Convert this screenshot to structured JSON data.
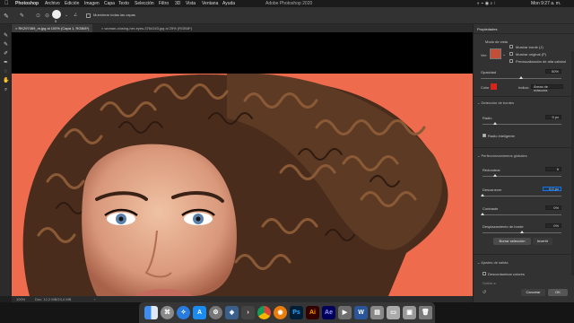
{
  "menubar": {
    "apple": "",
    "items": [
      "Photoshop",
      "Archivo",
      "Edición",
      "Imagen",
      "Capa",
      "Texto",
      "Selección",
      "Filtro",
      "3D",
      "Vista",
      "Ventana",
      "Ayuda"
    ],
    "window_title": "Adobe Photoshop 2020",
    "clock": "Mon 9:27 a. m."
  },
  "optbar": {
    "size_value": "5",
    "sample_all_layers": "Muestrear todas las capas"
  },
  "tabs": [
    {
      "label": "RK297469_m.jpg al 100% (Capa 1, RGB/8*)"
    },
    {
      "label": "woman-closing-her-eyes-3764163.jpg al 25% (RGB/8*)"
    }
  ],
  "status": {
    "zoom": "100%",
    "doc": "Doc: 12,2 MB/24,4 MB"
  },
  "panel": {
    "title": "Propiedades",
    "view_mode_label": "Modo de vista",
    "view_label": "Ver:",
    "show_edge": "Mostrar borde (J)",
    "show_original": "Mostrar original (P)",
    "hq_preview": "Previsualización de alta calidad",
    "opacity_label": "Opacidad",
    "opacity_value": "50%",
    "color_label": "Color",
    "indicate_label": "Indica:",
    "indicate_value": "Áreas de máscara",
    "edge_detection": "Detección de bordes",
    "radius_label": "Radio",
    "radius_value": "5 px",
    "smart_radius": "Radio inteligente",
    "global_refinements": "Perfeccionamientos globales",
    "smooth_label": "Redondear",
    "smooth_value": "6",
    "feather_label": "Desvanecer",
    "feather_value": "0,0 px",
    "contrast_label": "Contraste",
    "contrast_value": "0%",
    "shift_edge_label": "Desplazamiento de borde",
    "shift_edge_value": "0%",
    "clear_selection": "Borrar selección",
    "invert": "Invertir",
    "output_settings": "Ajustes de salida",
    "decontaminate": "Descontaminar colores",
    "output_to_label": "Salida a:",
    "cancel": "Cancelar",
    "ok": "OK"
  },
  "colors": {
    "photo_bg": "#ef6b4d",
    "edge_color": "#d8241b",
    "accent": "#1473e6"
  },
  "dock": {
    "icons": [
      "finder-icon",
      "launchpad-icon",
      "safari-icon",
      "app-store-icon",
      "settings-icon",
      "photos-icon",
      "chrome-icon",
      "blender-icon",
      "photoshop-icon",
      "illustrator-icon",
      "after-effects-icon",
      "word-icon",
      "terminal-icon",
      "preview-icon",
      "trash-icon"
    ],
    "ps_label": "Ps",
    "ai_label": "Ai",
    "ae_label": "Ae",
    "w_label": "W"
  }
}
